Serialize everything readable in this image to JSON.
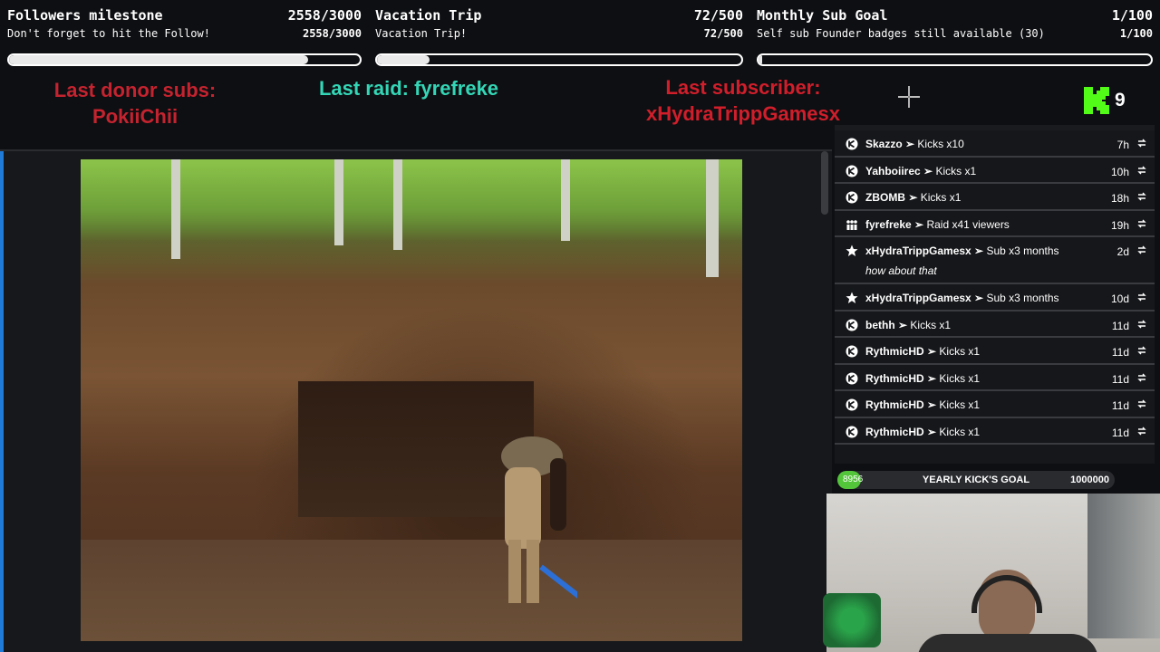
{
  "goals": [
    {
      "title": "Followers milestone",
      "count": "2558/3000",
      "sub": "Don't forget to hit the Follow!",
      "subcount": "2558/3000",
      "progress": 0.853
    },
    {
      "title": "Vacation Trip",
      "count": "72/500",
      "sub": "Vacation Trip!",
      "subcount": "72/500",
      "progress": 0.144
    },
    {
      "title": "Monthly Sub Goal",
      "count": "1/100",
      "sub": "Self sub Founder badges still available (30)",
      "subcount": "1/100",
      "progress": 0.01
    }
  ],
  "last": {
    "donor_label": "Last donor subs:",
    "donor_name": "PokiiChii",
    "raid": "Last raid: fyrefreke",
    "sub_label": "Last subscriber:",
    "sub_name": "xHydraTrippGamesx"
  },
  "kick": {
    "count": "9",
    "brand_color": "#53fc18"
  },
  "events": [
    {
      "icon": "kick-icon",
      "name": "Skazzo",
      "action": "Kicks x10",
      "time": "7h"
    },
    {
      "icon": "kick-icon",
      "name": "Yahboiirec",
      "action": "Kicks x1",
      "time": "10h"
    },
    {
      "icon": "kick-icon",
      "name": "ZBOMB",
      "action": "Kicks x1",
      "time": "18h"
    },
    {
      "icon": "raid-icon",
      "name": "fyrefreke",
      "action": "Raid x41 viewers",
      "time": "19h"
    },
    {
      "icon": "star-icon",
      "name": "xHydraTrippGamesx",
      "action": "Sub x3 months",
      "time": "2d",
      "message": "how about that"
    },
    {
      "icon": "star-icon",
      "name": "xHydraTrippGamesx",
      "action": "Sub x3 months",
      "time": "10d"
    },
    {
      "icon": "kick-icon",
      "name": "bethh",
      "action": "Kicks x1",
      "time": "11d"
    },
    {
      "icon": "kick-icon",
      "name": "RythmicHD",
      "action": "Kicks x1",
      "time": "11d"
    },
    {
      "icon": "kick-icon",
      "name": "RythmicHD",
      "action": "Kicks x1",
      "time": "11d"
    },
    {
      "icon": "kick-icon",
      "name": "RythmicHD",
      "action": "Kicks x1",
      "time": "11d"
    },
    {
      "icon": "kick-icon",
      "name": "RythmicHD",
      "action": "Kicks x1",
      "time": "11d"
    }
  ],
  "yearly": {
    "current": "8956",
    "title": "YEARLY KICK'S GOAL",
    "max": "1000000",
    "progress": 0.009
  }
}
